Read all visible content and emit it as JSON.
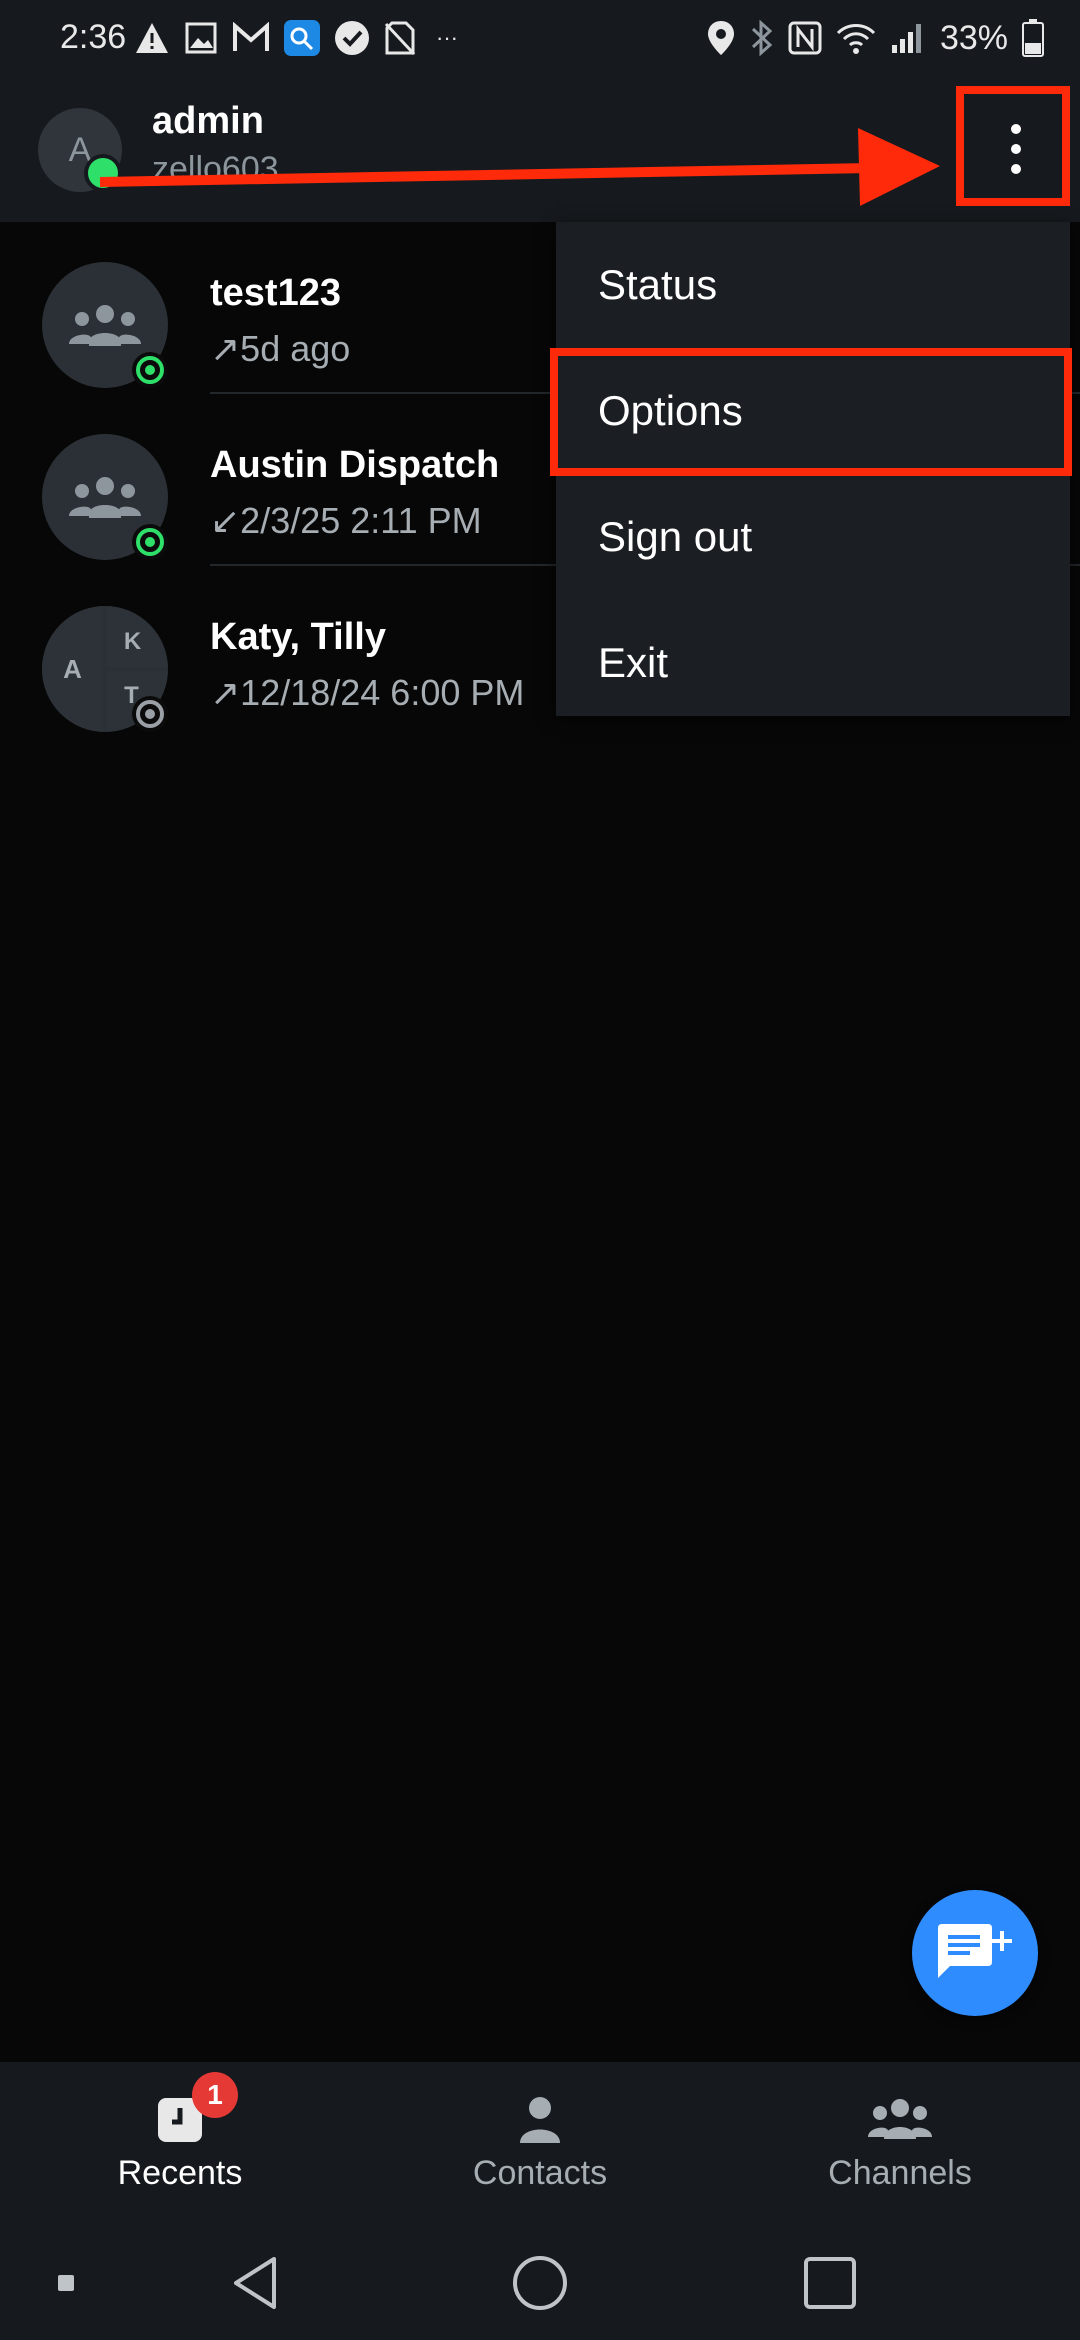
{
  "status_bar": {
    "time": "2:36",
    "battery_percent": "33%",
    "left_icons": [
      "warning-icon",
      "image-icon",
      "gmail-icon",
      "app-icon",
      "check-circle-icon",
      "no-sim-icon",
      "more-notifications-icon"
    ],
    "overflow_glyph": "···",
    "right_icons": [
      "location-icon",
      "bluetooth-icon",
      "nfc-icon",
      "wifi-icon",
      "signal-icon",
      "battery-icon"
    ]
  },
  "app_bar": {
    "avatar_letter": "A",
    "username": "admin",
    "subtitle": "zello603",
    "presence": "online"
  },
  "recents": [
    {
      "title": "test123",
      "direction": "↗",
      "time": "5d ago",
      "status": "online"
    },
    {
      "title": "Austin Dispatch",
      "direction": "↙",
      "time": "2/3/25 2:11 PM",
      "status": "online"
    },
    {
      "title": "Katy, Tilly",
      "direction": "↗",
      "time": "12/18/24 6:00 PM",
      "status": "away",
      "initials": [
        "A",
        "K",
        "T"
      ]
    }
  ],
  "menu": {
    "items": [
      "Status",
      "Options",
      "Sign out",
      "Exit"
    ],
    "highlighted": "Options"
  },
  "bottom_nav": {
    "tabs": [
      {
        "label": "Recents",
        "icon": "clock-icon",
        "active": true,
        "badge": "1"
      },
      {
        "label": "Contacts",
        "icon": "person-icon",
        "active": false
      },
      {
        "label": "Channels",
        "icon": "group-icon",
        "active": false
      }
    ]
  },
  "colors": {
    "accent": "#2f8cff",
    "online": "#2ee06a",
    "annotation": "#ff2a0a",
    "badge": "#e53935"
  }
}
